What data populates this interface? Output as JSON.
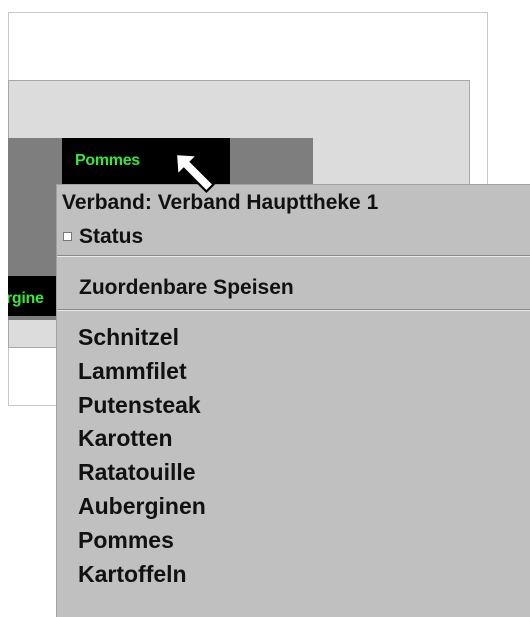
{
  "tiles": {
    "pommes_label": "Pommes",
    "auberginen_label": "rgine"
  },
  "tooltip": {
    "header": "Verband: Verband Haupttheke 1",
    "status_label": "Status",
    "section_label": "Zuordenbare Speisen",
    "items": [
      "Schnitzel",
      "Lammfilet",
      "Putensteak",
      "Karotten",
      "Ratatouille",
      "Auberginen",
      "Pommes",
      "Kartoffeln"
    ]
  },
  "colors": {
    "tile_bg": "#000000",
    "tile_text": "#39e639",
    "tooltip_bg": "#c0c0c0",
    "panel_bg": "#dcdcdc",
    "bar_bg": "#7e7e7e"
  },
  "icons": {
    "cursor": "pointer-arrow-icon",
    "status_checkbox": "checkbox-icon"
  }
}
